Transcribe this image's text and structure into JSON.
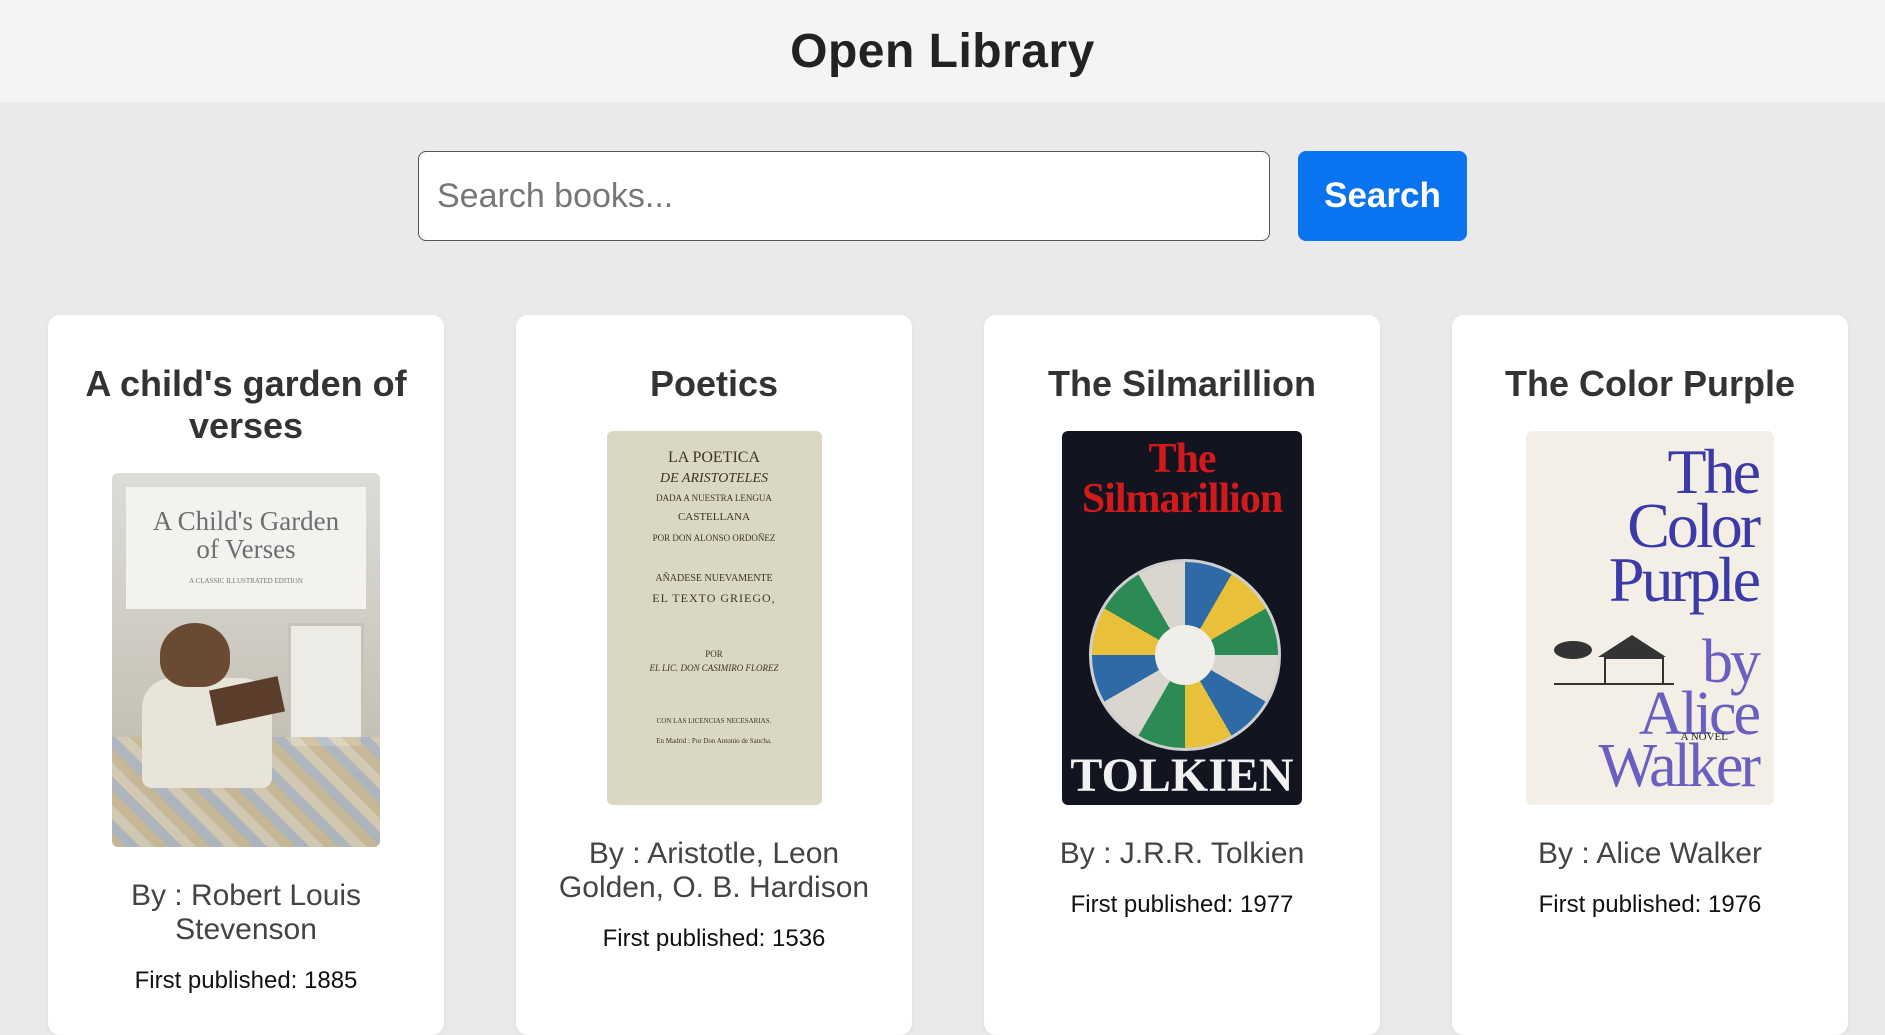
{
  "header": {
    "title": "Open Library"
  },
  "search": {
    "placeholder": "Search books...",
    "button_label": "Search"
  },
  "books": [
    {
      "title": "A child's garden of verses",
      "author": "By : Robert Louis Stevenson",
      "published": "First published: 1885",
      "cover_text": [
        "A Child's Garden",
        "of Verses",
        "A CLASSIC ILLUSTRATED EDITION"
      ]
    },
    {
      "title": "Poetics",
      "author": "By : Aristotle, Leon Golden, O. B. Hardison",
      "published": "First published: 1536",
      "cover_text": [
        "LA POETICA",
        "DE ARISTOTELES",
        "DADA A NUESTRA LENGUA",
        "CASTELLANA",
        "POR DON ALONSO ORDOÑEZ",
        "AÑADESE NUEVAMENTE",
        "EL TEXTO GRIEGO,",
        "POR",
        "EL LIC. DON CASIMIRO FLOREZ",
        "CON LAS LICENCIAS NECESARIAS.",
        "En Madrid : Por Don Antonio de Sancha."
      ]
    },
    {
      "title": "The Silmarillion",
      "author": "By : J.R.R. Tolkien",
      "published": "First published: 1977",
      "cover_text": [
        "The",
        "Silmarillion",
        "TOLKIEN"
      ]
    },
    {
      "title": "The Color Purple",
      "author": "By : Alice Walker",
      "published": "First published: 1976",
      "cover_text": [
        "The",
        "Color",
        "Purple",
        "by",
        "Alice",
        "Walker",
        "A NOVEL"
      ]
    }
  ],
  "colors": {
    "accent": "#0a74f0",
    "header_bg": "#f4f4f4",
    "page_bg": "#ebeaea"
  }
}
